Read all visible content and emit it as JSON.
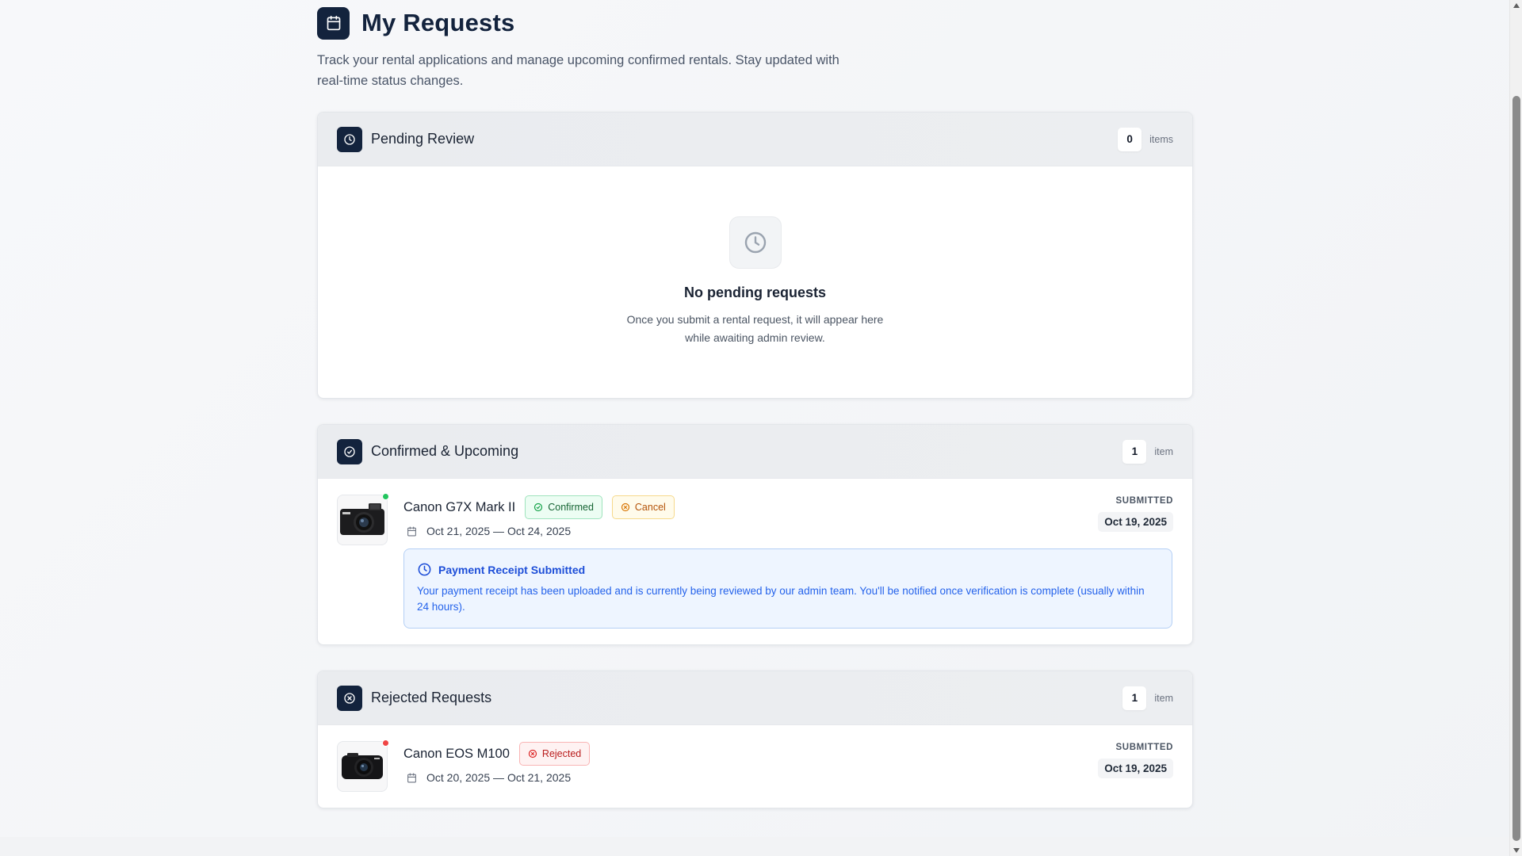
{
  "header": {
    "icon": "calendar-icon",
    "title": "My Requests",
    "subtitle": "Track your rental applications and manage upcoming confirmed rentals. Stay updated with real-time status changes."
  },
  "sections": {
    "pending": {
      "icon": "clock-icon",
      "title": "Pending Review",
      "count": "0",
      "count_label": "items",
      "empty_icon": "clock-icon",
      "empty_title": "No pending requests",
      "empty_text": "Once you submit a rental request, it will appear here while awaiting admin review."
    },
    "confirmed": {
      "icon": "check-circle-icon",
      "title": "Confirmed & Upcoming",
      "count": "1",
      "count_label": "item",
      "items": [
        {
          "name": "Canon G7X Mark II",
          "status": "Confirmed",
          "action": "Cancel",
          "dates": "Oct 21, 2025 — Oct 24, 2025",
          "submitted_label": "SUBMITTED",
          "submitted_date": "Oct 19, 2025",
          "status_color": "#22c55e",
          "notice_title": "Payment Receipt Submitted",
          "notice_text": "Your payment receipt has been uploaded and is currently being reviewed by our admin team. You'll be notified once verification is complete (usually within 24 hours)."
        }
      ]
    },
    "rejected": {
      "icon": "x-circle-icon",
      "title": "Rejected Requests",
      "count": "1",
      "count_label": "item",
      "items": [
        {
          "name": "Canon EOS M100",
          "status": "Rejected",
          "dates": "Oct 20, 2025 — Oct 21, 2025",
          "submitted_label": "SUBMITTED",
          "submitted_date": "Oct 19, 2025",
          "status_color": "#ef4444"
        }
      ]
    }
  },
  "colors": {
    "brand_dark": "#13233d",
    "confirmed": "#166534",
    "warning": "#b45309",
    "rejected": "#b91c1c",
    "info": "#2563eb"
  }
}
